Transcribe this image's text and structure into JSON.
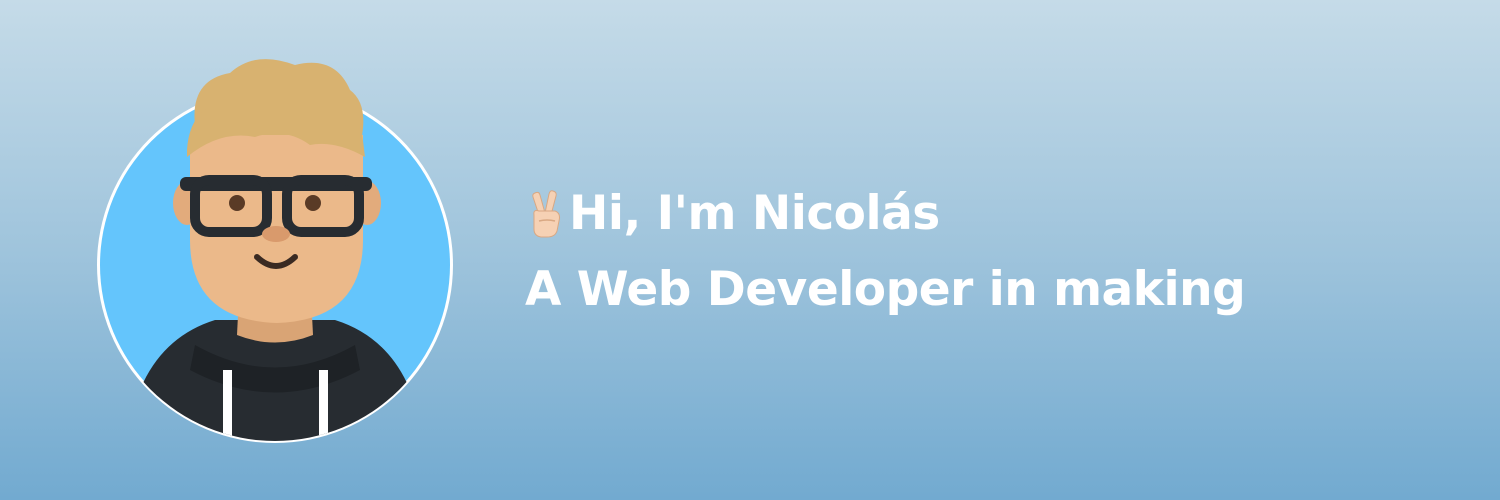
{
  "banner": {
    "greeting_icon": "victory-hand-icon",
    "greeting_line": "Hi, I'm Nicolás",
    "tagline_line": "A Web Developer in making",
    "avatar_icon": "developer-avatar-illustration",
    "colors": {
      "background_top": "#c5dbe8",
      "background_bottom": "#72aad0",
      "avatar_circle": "#64c5fc",
      "text": "#ffffff",
      "hair": "#d8b270",
      "skin": "#ebb98a",
      "hoodie": "#272c31"
    }
  }
}
